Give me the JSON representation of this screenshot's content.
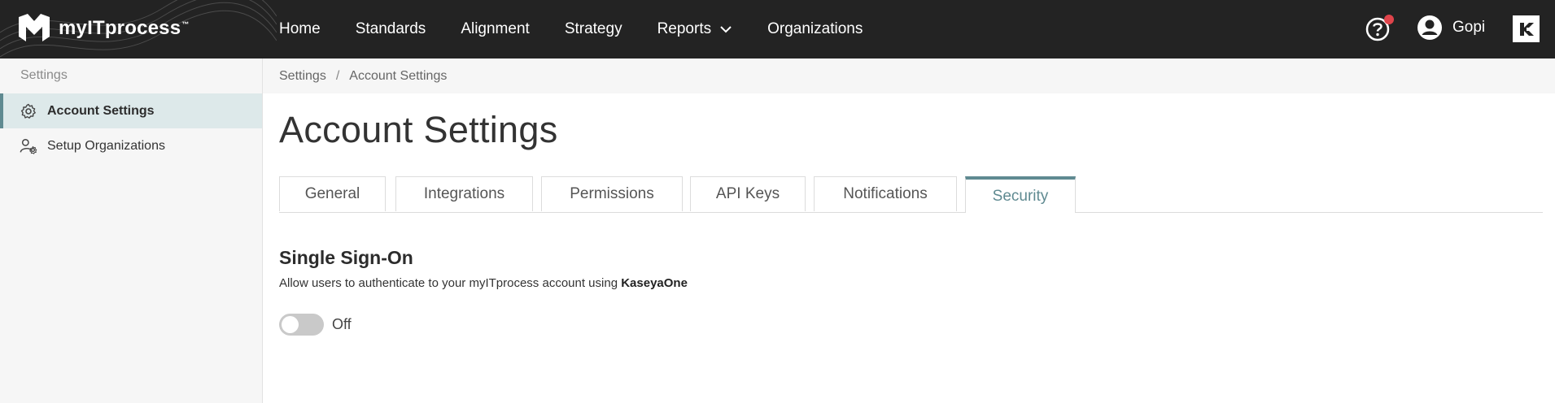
{
  "header": {
    "logo_text": "myITprocess",
    "logo_tm": "™",
    "nav": [
      {
        "label": "Home"
      },
      {
        "label": "Standards"
      },
      {
        "label": "Alignment"
      },
      {
        "label": "Strategy"
      },
      {
        "label": "Reports"
      },
      {
        "label": "Organizations"
      }
    ],
    "user_name": "Gopi"
  },
  "sidebar": {
    "header": "Settings",
    "items": [
      {
        "label": "Account Settings",
        "icon": "gear-icon",
        "active": true
      },
      {
        "label": "Setup Organizations",
        "icon": "user-gear-icon",
        "active": false
      }
    ]
  },
  "breadcrumb": {
    "items": [
      "Settings",
      "Account Settings"
    ],
    "separator": "/"
  },
  "main": {
    "title": "Account Settings",
    "tabs": [
      {
        "label": "General"
      },
      {
        "label": "Integrations"
      },
      {
        "label": "Permissions"
      },
      {
        "label": "API Keys"
      },
      {
        "label": "Notifications"
      },
      {
        "label": "Security",
        "active": true
      }
    ],
    "sso": {
      "title": "Single Sign-On",
      "description_prefix": "Allow users to authenticate to your myITprocess account using ",
      "description_strong": "KaseyaOne",
      "toggle_state": "Off"
    }
  },
  "colors": {
    "accent": "#5f8a91",
    "topbar": "#232323",
    "notification_dot": "#e0444b"
  }
}
